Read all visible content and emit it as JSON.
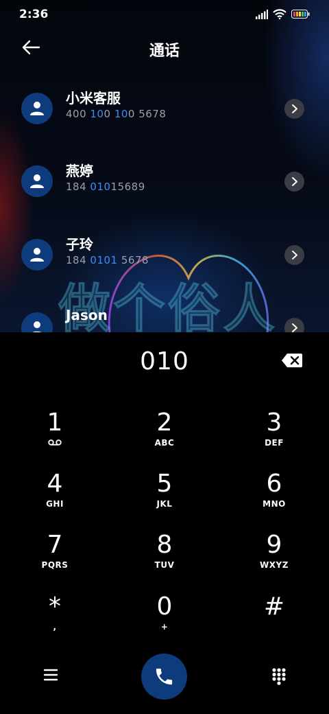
{
  "status_bar": {
    "time": "2:36"
  },
  "header": {
    "title": "通话"
  },
  "watermark": "做个俗人",
  "contacts": [
    {
      "name": "小米客服",
      "number_parts": [
        "400 ",
        "10",
        "0 ",
        "10",
        "0 5678"
      ]
    },
    {
      "name": "燕婷",
      "number_parts": [
        "184 ",
        "010",
        "15689"
      ]
    },
    {
      "name": "子玲",
      "number_parts": [
        "184 ",
        "0101",
        " 5678"
      ]
    },
    {
      "name": "Jason"
    }
  ],
  "dialer": {
    "dialed_number": "010",
    "keys": [
      {
        "digit": "1",
        "letters": "",
        "icon": "voicemail-icon"
      },
      {
        "digit": "2",
        "letters": "ABC"
      },
      {
        "digit": "3",
        "letters": "DEF"
      },
      {
        "digit": "4",
        "letters": "GHI"
      },
      {
        "digit": "5",
        "letters": "JKL"
      },
      {
        "digit": "6",
        "letters": "MNO"
      },
      {
        "digit": "7",
        "letters": "PQRS"
      },
      {
        "digit": "8",
        "letters": "TUV"
      },
      {
        "digit": "9",
        "letters": "WXYZ"
      },
      {
        "digit": "*",
        "letters": ","
      },
      {
        "digit": "0",
        "letters": "+"
      },
      {
        "digit": "#",
        "letters": ""
      }
    ]
  },
  "colors": {
    "accent": "#0d3b7c",
    "highlight": "#3a8ff0",
    "background": "#000000"
  },
  "icons": [
    "back-arrow-icon",
    "signal-icon",
    "wifi-icon",
    "battery-icon",
    "person-icon",
    "chevron-right-icon",
    "backspace-icon",
    "menu-icon",
    "phone-icon",
    "keypad-icon"
  ]
}
